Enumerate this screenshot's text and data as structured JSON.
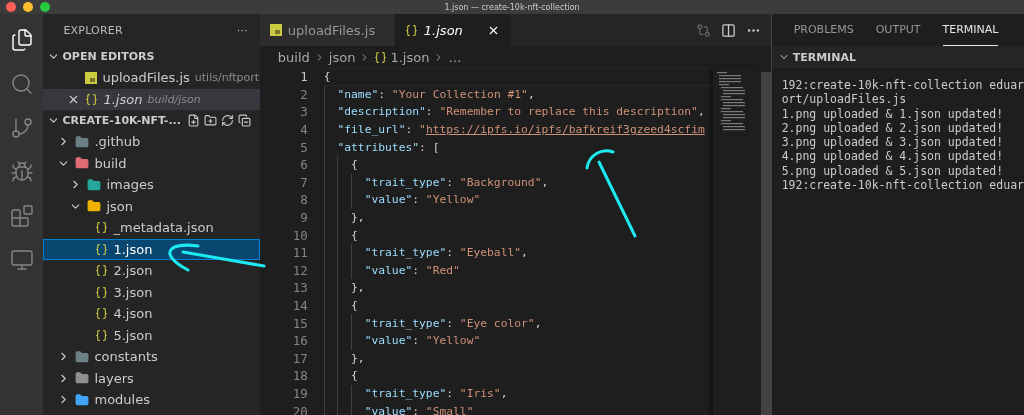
{
  "window": {
    "title": "1.json — create-10k-nft-collection"
  },
  "activity_bar": [
    {
      "kind": "files",
      "selected": true
    },
    {
      "kind": "search",
      "selected": false
    },
    {
      "kind": "source-control",
      "selected": false
    },
    {
      "kind": "debug",
      "selected": false
    },
    {
      "kind": "extensions",
      "selected": false
    },
    {
      "kind": "remote",
      "selected": false
    }
  ],
  "sidebar": {
    "title": "EXPLORER",
    "more": "···",
    "open_editors": {
      "title": "OPEN EDITORS",
      "expanded": true,
      "items": [
        {
          "name": "uploadFiles.js",
          "path": "utils/nftport",
          "kind": "js",
          "selected": false,
          "preview": false
        },
        {
          "name": "1.json",
          "path": "build/json",
          "kind": "json",
          "selected": true,
          "preview": true
        }
      ]
    },
    "project": {
      "title": "CREATE-10K-NFT-...",
      "expanded": true,
      "items": [
        {
          "name": ".github",
          "kind": "github-folder",
          "expanded": false,
          "selected": false
        },
        {
          "name": "build",
          "kind": "build-folder",
          "expanded": true,
          "selected": false,
          "children": [
            {
              "name": "images",
              "kind": "images-folder",
              "expanded": false,
              "selected": false
            },
            {
              "name": "json",
              "kind": "json-folder",
              "expanded": true,
              "selected": false,
              "children": [
                {
                  "name": "_metadata.json",
                  "kind": "json",
                  "selected": false
                },
                {
                  "name": "1.json",
                  "kind": "json",
                  "selected": true
                },
                {
                  "name": "2.json",
                  "kind": "json",
                  "selected": false
                },
                {
                  "name": "3.json",
                  "kind": "json",
                  "selected": false
                },
                {
                  "name": "4.json",
                  "kind": "json",
                  "selected": false
                },
                {
                  "name": "5.json",
                  "kind": "json",
                  "selected": false
                }
              ]
            }
          ]
        },
        {
          "name": "constants",
          "kind": "constants-folder",
          "expanded": false,
          "selected": false
        },
        {
          "name": "layers",
          "kind": "plain-folder",
          "expanded": false,
          "selected": false
        },
        {
          "name": "modules",
          "kind": "modules-folder",
          "expanded": false,
          "selected": false
        }
      ]
    }
  },
  "editor": {
    "tabs": [
      {
        "label": "uploadFiles.js",
        "kind": "js",
        "selected": false,
        "preview": false
      },
      {
        "label": "1.json",
        "kind": "json",
        "selected": true,
        "preview": true
      }
    ],
    "breadcrumbs": [
      {
        "label": "build",
        "kind": "folder"
      },
      {
        "label": "json",
        "kind": "folder"
      },
      {
        "label": "1.json",
        "kind": "json"
      },
      {
        "label": "…",
        "kind": "more"
      }
    ],
    "lines": [
      {
        "number": "1",
        "current": true,
        "tokens": [
          {
            "kind": "punct",
            "text": "{"
          }
        ]
      },
      {
        "number": "2",
        "current": false,
        "tokens": [
          {
            "kind": "key",
            "text": "\"name\""
          },
          {
            "kind": "punct",
            "text": ": "
          },
          {
            "kind": "string",
            "text": "\"Your Collection #1\""
          },
          {
            "kind": "punct",
            "text": ","
          }
        ]
      },
      {
        "number": "3",
        "current": false,
        "tokens": [
          {
            "kind": "key",
            "text": "\"description\""
          },
          {
            "kind": "punct",
            "text": ": "
          },
          {
            "kind": "string",
            "text": "\"Remember to replace this description\""
          },
          {
            "kind": "punct",
            "text": ","
          }
        ]
      },
      {
        "number": "4",
        "current": false,
        "tokens": [
          {
            "kind": "key",
            "text": "\"file_url\""
          },
          {
            "kind": "punct",
            "text": ": "
          },
          {
            "kind": "string",
            "text": "\""
          },
          {
            "kind": "link",
            "text": "https://ipfs.io/ipfs/bafkreif3gzeed4scfim"
          }
        ]
      },
      {
        "number": "5",
        "current": false,
        "tokens": [
          {
            "kind": "key",
            "text": "\"attributes\""
          },
          {
            "kind": "punct",
            "text": ": ["
          }
        ]
      },
      {
        "number": "6",
        "current": false,
        "tokens": [
          {
            "kind": "punct",
            "text": "{"
          }
        ]
      },
      {
        "number": "7",
        "current": false,
        "tokens": [
          {
            "kind": "key",
            "text": "\"trait_type\""
          },
          {
            "kind": "punct",
            "text": ": "
          },
          {
            "kind": "string",
            "text": "\"Background\""
          },
          {
            "kind": "punct",
            "text": ","
          }
        ]
      },
      {
        "number": "8",
        "current": false,
        "tokens": [
          {
            "kind": "key",
            "text": "\"value\""
          },
          {
            "kind": "punct",
            "text": ": "
          },
          {
            "kind": "string",
            "text": "\"Yellow\""
          }
        ]
      },
      {
        "number": "9",
        "current": false,
        "tokens": [
          {
            "kind": "punct",
            "text": "},"
          }
        ]
      },
      {
        "number": "10",
        "current": false,
        "tokens": [
          {
            "kind": "punct",
            "text": "{"
          }
        ]
      },
      {
        "number": "11",
        "current": false,
        "tokens": [
          {
            "kind": "key",
            "text": "\"trait_type\""
          },
          {
            "kind": "punct",
            "text": ": "
          },
          {
            "kind": "string",
            "text": "\"Eyeball\""
          },
          {
            "kind": "punct",
            "text": ","
          }
        ]
      },
      {
        "number": "12",
        "current": false,
        "tokens": [
          {
            "kind": "key",
            "text": "\"value\""
          },
          {
            "kind": "punct",
            "text": ": "
          },
          {
            "kind": "string",
            "text": "\"Red\""
          }
        ]
      },
      {
        "number": "13",
        "current": false,
        "tokens": [
          {
            "kind": "punct",
            "text": "},"
          }
        ]
      },
      {
        "number": "14",
        "current": false,
        "tokens": [
          {
            "kind": "punct",
            "text": "{"
          }
        ]
      },
      {
        "number": "15",
        "current": false,
        "tokens": [
          {
            "kind": "key",
            "text": "\"trait_type\""
          },
          {
            "kind": "punct",
            "text": ": "
          },
          {
            "kind": "string",
            "text": "\"Eye color\""
          },
          {
            "kind": "punct",
            "text": ","
          }
        ]
      },
      {
        "number": "16",
        "current": false,
        "tokens": [
          {
            "kind": "key",
            "text": "\"value\""
          },
          {
            "kind": "punct",
            "text": ": "
          },
          {
            "kind": "string",
            "text": "\"Yellow\""
          }
        ]
      },
      {
        "number": "17",
        "current": false,
        "tokens": [
          {
            "kind": "punct",
            "text": "},"
          }
        ]
      },
      {
        "number": "18",
        "current": false,
        "tokens": [
          {
            "kind": "punct",
            "text": "{"
          }
        ]
      },
      {
        "number": "19",
        "current": false,
        "tokens": [
          {
            "kind": "key",
            "text": "\"trait_type\""
          },
          {
            "kind": "punct",
            "text": ": "
          },
          {
            "kind": "string",
            "text": "\"Iris\""
          },
          {
            "kind": "punct",
            "text": ","
          }
        ]
      },
      {
        "number": "20",
        "current": false,
        "tokens": [
          {
            "kind": "key",
            "text": "\"value\""
          },
          {
            "kind": "punct",
            "text": ": "
          },
          {
            "kind": "string",
            "text": "\"Small\""
          }
        ]
      }
    ]
  },
  "panel": {
    "tabs": [
      {
        "label": "PROBLEMS",
        "selected": false
      },
      {
        "label": "OUTPUT",
        "selected": false
      },
      {
        "label": "TERMINAL",
        "selected": true
      }
    ],
    "section": {
      "title": "TERMINAL",
      "expanded": true
    },
    "terminal_lines": [
      "192:create-10k-nft-collection eduar",
      "ort/uploadFiles.js",
      "1.png uploaded & 1.json updated!",
      "2.png uploaded & 2.json updated!",
      "3.png uploaded & 3.json updated!",
      "4.png uploaded & 4.json updated!",
      "5.png uploaded & 5.json updated!",
      "192:create-10k-nft-collection eduar"
    ]
  }
}
